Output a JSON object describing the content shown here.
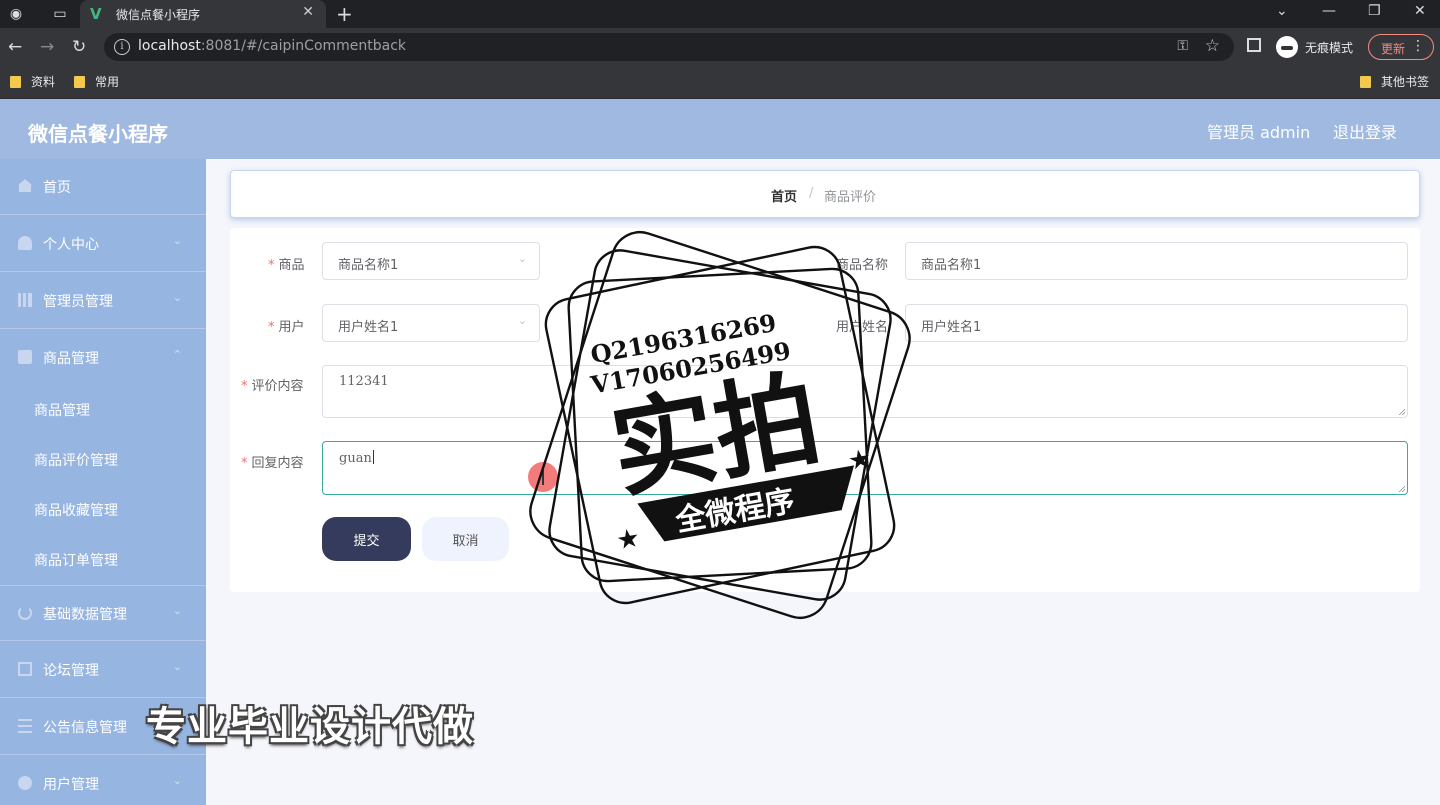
{
  "browser": {
    "tab_title": "微信点餐小程序",
    "url_host": "localhost",
    "url_rest": ":8081/#/caipinCommentback",
    "incognito_label": "无痕模式",
    "update_label": "更新",
    "bookmarks": [
      "资料",
      "常用"
    ],
    "other_bookmarks": "其他书签"
  },
  "header": {
    "brand": "微信点餐小程序",
    "admin_label": "管理员 admin",
    "logout": "退出登录"
  },
  "sidebar": {
    "items": [
      {
        "label": "首页",
        "icon": "home-icon"
      },
      {
        "label": "个人中心",
        "icon": "user-icon"
      },
      {
        "label": "管理员管理",
        "icon": "bar-chart-icon"
      },
      {
        "label": "商品管理",
        "icon": "shopping-bag-icon"
      },
      {
        "label": "基础数据管理",
        "icon": "refresh-icon"
      },
      {
        "label": "论坛管理",
        "icon": "edit-icon"
      },
      {
        "label": "公告信息管理",
        "icon": "list-icon"
      },
      {
        "label": "用户管理",
        "icon": "person-icon"
      }
    ],
    "subitems": [
      "商品管理",
      "商品评价管理",
      "商品收藏管理",
      "商品订单管理"
    ]
  },
  "breadcrumb": {
    "home": "首页",
    "separator": "/",
    "current": "商品评价"
  },
  "form": {
    "goods_label": "商品",
    "goods_value": "商品名称1",
    "goods_name_label": "商品名称",
    "goods_name_value": "商品名称1",
    "user_label": "用户",
    "user_value": "用户姓名1",
    "user_name_label": "用户姓名",
    "user_name_value": "用户姓名1",
    "comment_label": "评价内容",
    "comment_value": "112341",
    "reply_label": "回复内容",
    "reply_value": "guan",
    "required_mark": "*",
    "submit": "提交",
    "cancel": "取消"
  },
  "watermark": {
    "qq": "Q2196316269",
    "wechat": "V17060256499",
    "main": "实拍",
    "ribbon": "全微程序",
    "promo": "专业毕业设计代做"
  },
  "colors": {
    "header_bg": "#9fb9e0",
    "sidebar_bg": "#97b5e1",
    "submit_bg": "#353b5c",
    "required": "#f56c6c",
    "active_border": "#3aa99e"
  }
}
